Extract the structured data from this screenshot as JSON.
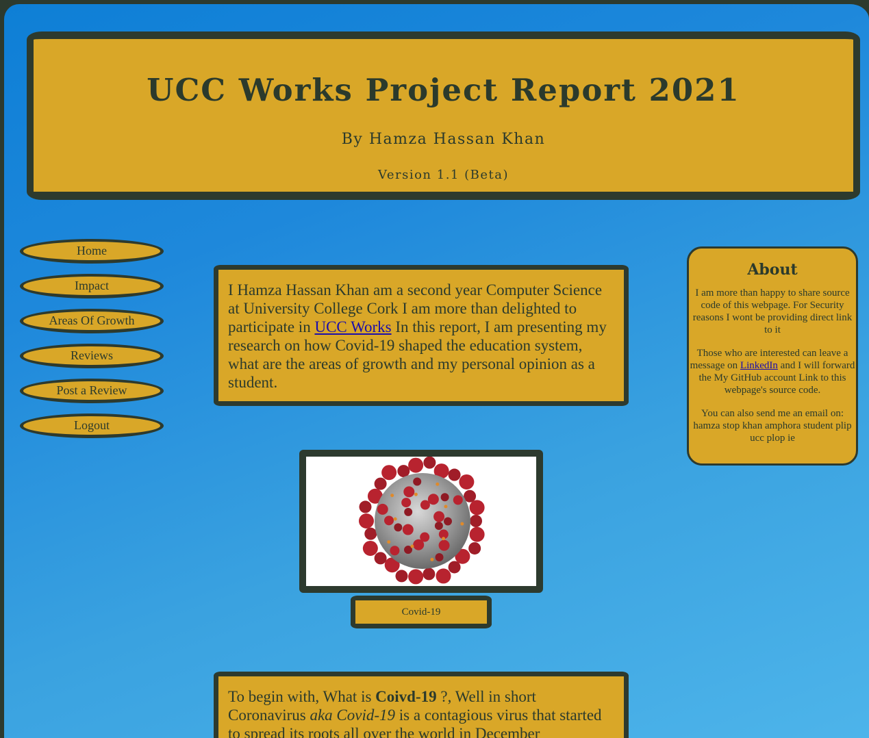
{
  "header": {
    "title": "UCC Works Project Report 2021",
    "byline": "By Hamza Hassan Khan",
    "version": "Version 1.1 (Beta)"
  },
  "nav": {
    "items": [
      {
        "label": "Home"
      },
      {
        "label": "Impact"
      },
      {
        "label": "Areas Of Growth"
      },
      {
        "label": "Reviews"
      },
      {
        "label": "Post a Review"
      },
      {
        "label": "Logout"
      }
    ]
  },
  "intro": {
    "text_before": "I Hamza Hassan Khan am a second year Computer Science at University College Cork I am more than delighted to participate in ",
    "link": "UCC Works",
    "text_after": " In this report, I am presenting my research on how Covid-19 shaped the education system, what are the areas of growth and my personal opinion as a student."
  },
  "figure": {
    "caption": "Covid-19"
  },
  "about": {
    "title": "About",
    "p1": "I am more than happy to share source code of this webpage. For Security reasons I wont be providing direct link to it",
    "p2_before": "Those who are interested can leave a message on ",
    "p2_link": "LinkedIn",
    "p2_after": " and I will forward the My GitHub account Link to this webpage's source code.",
    "p3": "You can also send me an email on: hamza stop khan amphora student plip ucc plop ie"
  },
  "para2": {
    "t1": "To begin with, What is ",
    "b1": "Coivd-19",
    "t2": " ?, Well in short Coronavirus ",
    "i1": "aka Covid-19",
    "t3": " is a contagious virus that started to spread its roots all over the world in December"
  },
  "colors": {
    "gold": "#d9a728",
    "dark": "#2d3a2e",
    "blue": "#1e88db",
    "link": "#1a0dab"
  }
}
